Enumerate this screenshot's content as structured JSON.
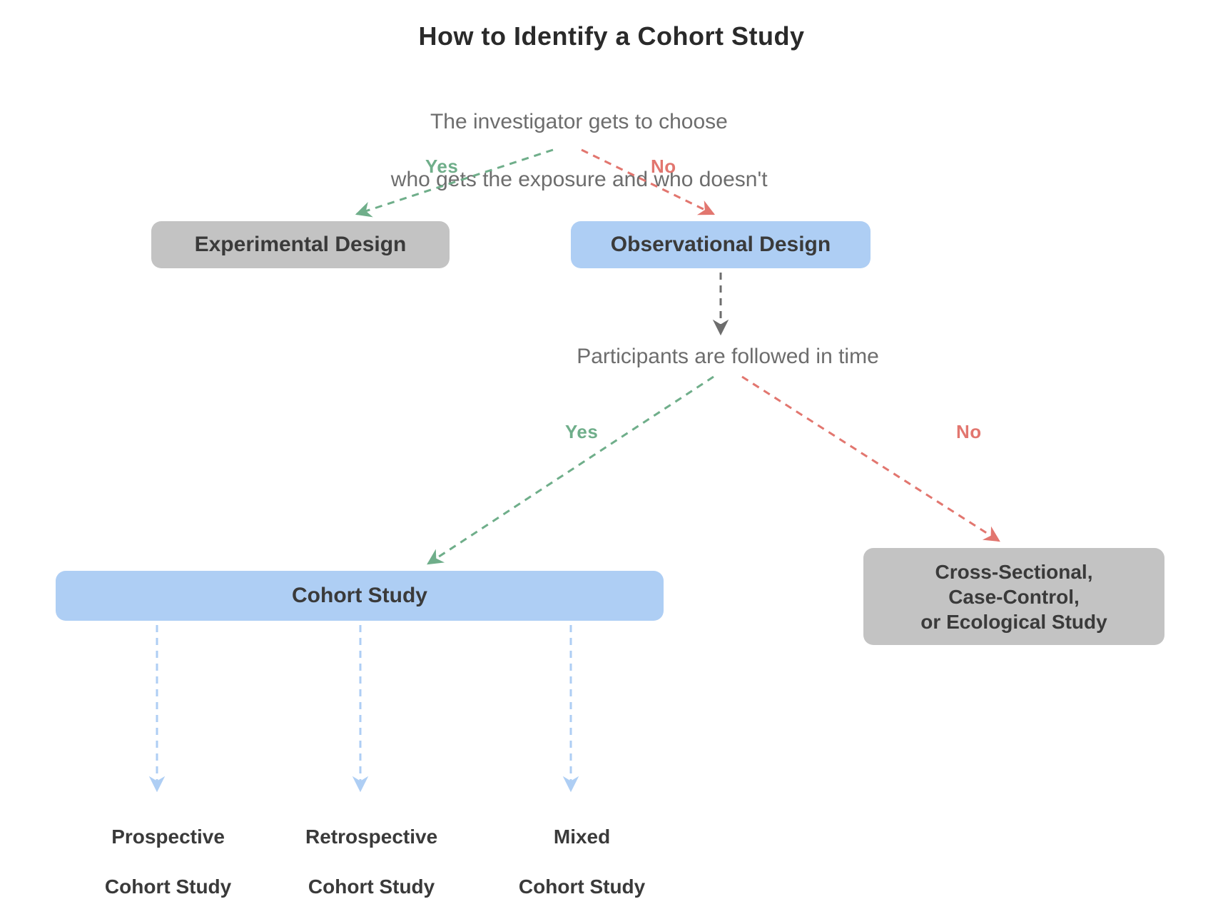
{
  "title": "How to Identify a Cohort Study",
  "q1_line1": "The investigator gets to choose",
  "q1_line2": "who gets the exposure and who doesn't",
  "q2": "Participants are followed in time",
  "labels": {
    "yes": "Yes",
    "no": "No"
  },
  "nodes": {
    "experimental": "Experimental Design",
    "observational": "Observational Design",
    "cohort": "Cohort Study",
    "cross_line1": "Cross-Sectional,",
    "cross_line2": "Case-Control,",
    "cross_line3": "or Ecological Study"
  },
  "leaves": {
    "prospective_l1": "Prospective",
    "prospective_l2": "Cohort Study",
    "retrospective_l1": "Retrospective",
    "retrospective_l2": "Cohort Study",
    "mixed_l1": "Mixed",
    "mixed_l2": "Cohort Study"
  },
  "colors": {
    "green": "#6fae8a",
    "red": "#e2766f",
    "grayArrow": "#6d6d6d",
    "lightBlue": "#aecef4"
  }
}
